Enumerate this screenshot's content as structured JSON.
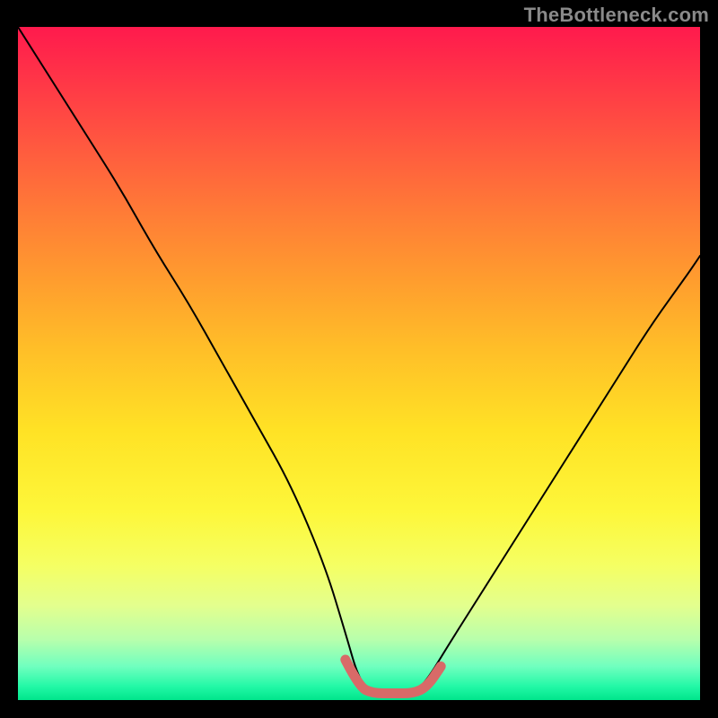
{
  "watermark": {
    "text": "TheBottleneck.com"
  },
  "chart_data": {
    "type": "line",
    "title": "",
    "xlabel": "",
    "ylabel": "",
    "xlim": [
      0,
      100
    ],
    "ylim": [
      0,
      100
    ],
    "grid": false,
    "legend": false,
    "series": [
      {
        "name": "bottleneck-curve",
        "color": "#000000",
        "x": [
          0,
          5,
          10,
          15,
          20,
          25,
          30,
          35,
          40,
          45,
          48,
          50,
          52,
          55,
          58,
          60,
          63,
          68,
          73,
          78,
          83,
          88,
          93,
          98,
          100
        ],
        "y": [
          100,
          92,
          84,
          76,
          67,
          59,
          50,
          41,
          32,
          20,
          10,
          3,
          1,
          1,
          1,
          3,
          8,
          16,
          24,
          32,
          40,
          48,
          56,
          63,
          66
        ]
      },
      {
        "name": "valley-highlight",
        "color": "#d86a68",
        "x": [
          48,
          50,
          52,
          55,
          58,
          60,
          62
        ],
        "y": [
          6,
          2,
          1,
          1,
          1,
          2,
          5
        ]
      }
    ],
    "annotations": []
  }
}
